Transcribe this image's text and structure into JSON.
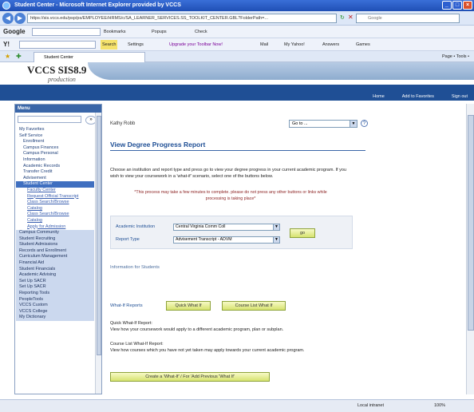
{
  "window": {
    "title": "Student Center - Microsoft Internet Explorer provided by VCCS"
  },
  "address": {
    "url": "https://sis.vccs.edu/psp/ps/EMPLOYEE/HRMS/c/SA_LEARNER_SERVICES.SS_TOOLKIT_CENTER.GBL?FolderPath=...",
    "search_placeholder": "Google"
  },
  "toolbar": {
    "google_label": "Google",
    "search_label": "Search",
    "yahoo_label": "Y!",
    "items": [
      "Bookmarks",
      "Popups",
      "Check",
      "Settings",
      "Upgrade your Toolbar Now!",
      "Mail",
      "My Yahoo!",
      "Answers",
      "Games"
    ]
  },
  "tabbar": {
    "tab_label": "Student Center",
    "right_items": "Page • Tools •"
  },
  "header": {
    "title": "VCCS SIS8.9",
    "subtitle": "production",
    "links": [
      "Home",
      "Add to Favorites",
      "Sign out"
    ]
  },
  "menu": {
    "heading": "Menu",
    "items": [
      {
        "label": "My Favorites",
        "level": 0,
        "selected": false,
        "section": false
      },
      {
        "label": "Self Service",
        "level": 0,
        "selected": false,
        "section": false
      },
      {
        "label": "Enrollment",
        "level": 1,
        "selected": false,
        "section": false
      },
      {
        "label": "Campus Finances",
        "level": 1,
        "selected": false,
        "section": false
      },
      {
        "label": "Campus Personal",
        "level": 1,
        "selected": false,
        "section": false
      },
      {
        "label": "Information",
        "level": 1,
        "selected": false,
        "section": false
      },
      {
        "label": "Academic Records",
        "level": 1,
        "selected": false,
        "section": false
      },
      {
        "label": "Transfer Credit",
        "level": 1,
        "selected": false,
        "section": false
      },
      {
        "label": "Advisement",
        "level": 1,
        "selected": false,
        "section": false
      },
      {
        "label": "Student Center",
        "level": 1,
        "selected": true,
        "section": false
      },
      {
        "label": "Faculty Center",
        "level": 2,
        "selected": false,
        "section": false
      },
      {
        "label": "Request Official Transcript",
        "level": 2,
        "selected": false,
        "section": false
      },
      {
        "label": "Class Search/Browse",
        "level": 2,
        "selected": false,
        "section": false
      },
      {
        "label": "Catalog",
        "level": 2,
        "selected": false,
        "section": false
      },
      {
        "label": "Class Search/Browse",
        "level": 2,
        "selected": false,
        "section": false
      },
      {
        "label": "Catalog",
        "level": 2,
        "selected": false,
        "section": false
      },
      {
        "label": "Apply for Admission",
        "level": 2,
        "selected": false,
        "section": false
      },
      {
        "label": "Campus Community",
        "level": 0,
        "selected": false,
        "section": true
      },
      {
        "label": "Student Recruiting",
        "level": 0,
        "selected": false,
        "section": true
      },
      {
        "label": "Student Admissions",
        "level": 0,
        "selected": false,
        "section": true
      },
      {
        "label": "Records and Enrollment",
        "level": 0,
        "selected": false,
        "section": true
      },
      {
        "label": "Curriculum Management",
        "level": 0,
        "selected": false,
        "section": true
      },
      {
        "label": "Financial Aid",
        "level": 0,
        "selected": false,
        "section": true
      },
      {
        "label": "Student Financials",
        "level": 0,
        "selected": false,
        "section": true
      },
      {
        "label": "Academic Advising",
        "level": 0,
        "selected": false,
        "section": true
      },
      {
        "label": "Set Up SACR",
        "level": 0,
        "selected": false,
        "section": true
      },
      {
        "label": "Set Up SACR",
        "level": 0,
        "selected": false,
        "section": true
      },
      {
        "label": "Reporting Tools",
        "level": 0,
        "selected": false,
        "section": true
      },
      {
        "label": "PeopleTools",
        "level": 0,
        "selected": false,
        "section": true
      },
      {
        "label": "VCCS Custom",
        "level": 0,
        "selected": false,
        "section": true
      },
      {
        "label": "VCCS College",
        "level": 0,
        "selected": false,
        "section": true
      },
      {
        "label": "My Dictionary",
        "level": 0,
        "selected": false,
        "section": true
      }
    ]
  },
  "content": {
    "user_name": "Kathy Robb",
    "goto_label": "Go to ...",
    "page_title": "View Degree Progress Report",
    "intro": "Choose an institution and report type and press go to view your degree progress in your current academic program. If you wish to view your coursework in a 'what-if' scenario, select one of the buttons below.",
    "notice": "*This process may take a few minutes to complete. please do not press any other buttons or links while processing is taking place*",
    "form": {
      "institution_label": "Academic Institution",
      "institution_value": "Central Virginia Comm Coll",
      "report_label": "Report Type",
      "report_value": "Advisement Transcript - ADVM",
      "go_label": "go"
    },
    "info_link": "Information for Students",
    "whatif_label": "What-If Reports",
    "quick_whatif_btn": "Quick What If",
    "course_list_btn": "Course List What If",
    "quick_title": "Quick What-If Report:",
    "quick_desc": "View how your coursework would apply to a different academic program, plan or subplan.",
    "course_title": "Course List What-If Report:",
    "course_desc": "View how courses which you have not yet taken may apply towards your current academic program.",
    "create_btn": "Create a 'What-If' / For 'Add Previous 'What If'"
  },
  "status": {
    "zone": "Local intranet",
    "zoom": "100%"
  }
}
